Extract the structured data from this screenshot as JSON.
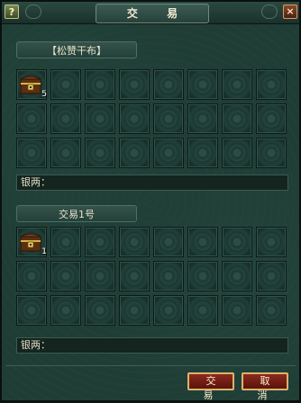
{
  "window": {
    "title": "交 易",
    "help_label": "?",
    "close_label": "×"
  },
  "partner": {
    "name": "【松赞干布】",
    "items": [
      {
        "icon": "treasure-chest-icon",
        "count": "5"
      }
    ],
    "money_label": "银两："
  },
  "self": {
    "name": "交易1号",
    "items": [
      {
        "icon": "treasure-chest-icon",
        "count": "1"
      }
    ],
    "money_label": "银两："
  },
  "buttons": {
    "trade_label": "交 易",
    "cancel_label": "取 消"
  },
  "colors": {
    "panel_bg": "#1f3d35",
    "slot_border": "#0e1a17",
    "button_red": "#8a2a1e",
    "button_gold_border": "#d9b46a",
    "text_light": "#e9e3cc"
  }
}
